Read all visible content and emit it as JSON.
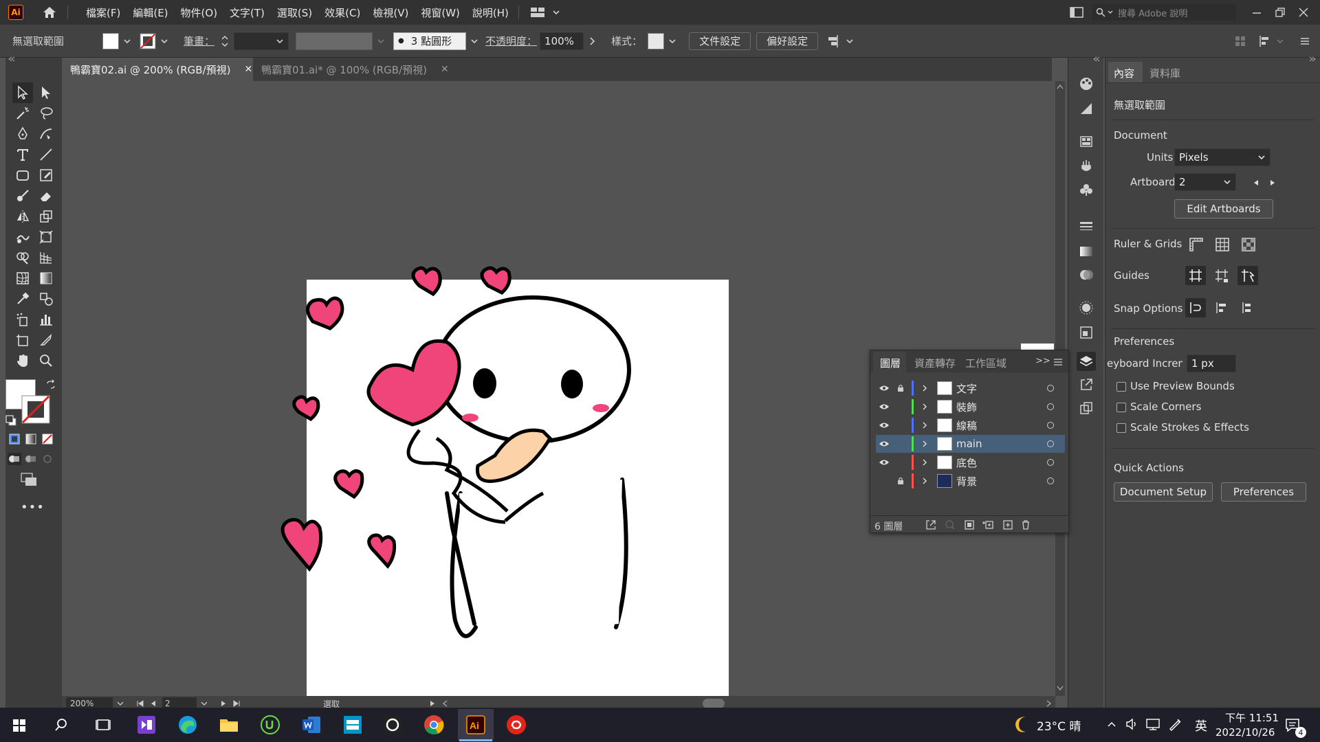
{
  "app": {
    "logo": "Ai",
    "brand_color": "#ff9a00"
  },
  "menu": {
    "items": [
      "檔案(F)",
      "編輯(E)",
      "物件(O)",
      "文字(T)",
      "選取(S)",
      "效果(C)",
      "檢視(V)",
      "視窗(W)",
      "說明(H)"
    ],
    "search_placeholder": "搜尋 Adobe 說明"
  },
  "control": {
    "no_selection": "無選取範圍",
    "stroke_label": "筆畫：",
    "brush": "3 點圓形",
    "opacity_label": "不透明度：",
    "opacity_value": "100%",
    "style_label": "樣式：",
    "doc_setup": "文件設定",
    "preferences": "偏好設定"
  },
  "tabs": [
    {
      "label": "鴨霸寶02.ai @ 200% (RGB/預視)",
      "active": true
    },
    {
      "label": "鴨霸寶01.ai* @ 100% (RGB/預視)",
      "active": false
    }
  ],
  "status": {
    "zoom": "200%",
    "artboard": "2",
    "tool": "選取"
  },
  "properties": {
    "tab_properties": "內容",
    "tab_libraries": "資料庫",
    "no_selection": "無選取範圍",
    "document": "Document",
    "units_label": "Units:",
    "units_value": "Pixels",
    "artboard_label": "Artboard:",
    "artboard_value": "2",
    "edit_artboards": "Edit Artboards",
    "ruler_grids": "Ruler & Grids",
    "guides": "Guides",
    "snap_options": "Snap Options",
    "preferences_title": "Preferences",
    "keyboard_increment_label": "eyboard Increment:",
    "keyboard_increment_value": "1 px",
    "use_preview_bounds": "Use Preview Bounds",
    "scale_corners": "Scale Corners",
    "scale_strokes": "Scale Strokes & Effects",
    "quick_actions": "Quick Actions",
    "document_setup_btn": "Document Setup",
    "preferences_btn": "Preferences"
  },
  "layers_panel": {
    "tabs": [
      "圖層",
      "資產轉存",
      "工作區域"
    ],
    "layers": [
      {
        "name": "文字",
        "color": "#4f6fff",
        "visible": true,
        "locked": true,
        "selected": false
      },
      {
        "name": "裝飾",
        "color": "#4fe04f",
        "visible": true,
        "locked": false,
        "selected": false
      },
      {
        "name": "線稿",
        "color": "#4f6fff",
        "visible": true,
        "locked": false,
        "selected": false
      },
      {
        "name": "main",
        "color": "#4fe04f",
        "visible": true,
        "locked": false,
        "selected": true
      },
      {
        "name": "底色",
        "color": "#ff4f4f",
        "visible": true,
        "locked": false,
        "selected": false
      },
      {
        "name": "背景",
        "color": "#ff4f4f",
        "visible": false,
        "locked": true,
        "selected": false
      }
    ],
    "count": "6 圖層"
  },
  "taskbar": {
    "weather": "23°C 晴",
    "ime": "英",
    "time": "下午 11:51",
    "date": "2022/10/26",
    "notifications": "4"
  }
}
